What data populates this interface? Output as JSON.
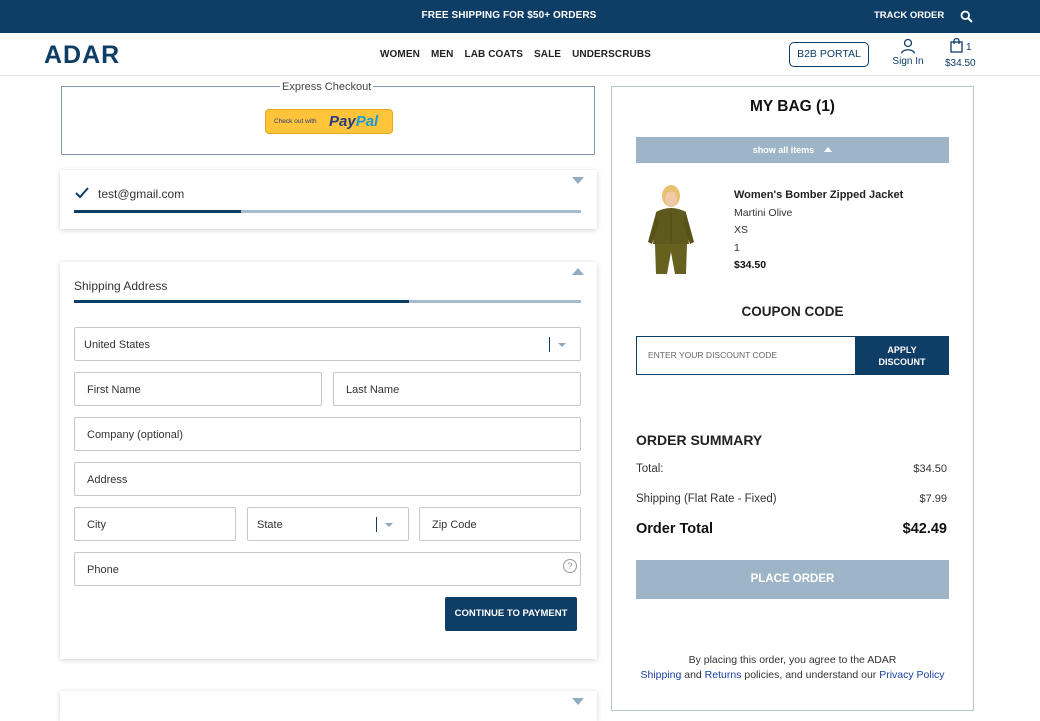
{
  "banner": {
    "promo": "FREE SHIPPING FOR $50+ ORDERS",
    "track_order": "TRACK ORDER",
    "search_icon": "search-icon"
  },
  "header": {
    "logo": "ADAR",
    "nav": [
      "WOMEN",
      "MEN",
      "LAB COATS",
      "SALE",
      "UNDERSCRUBS"
    ],
    "b2b": "B2B PORTAL",
    "sign_in": "Sign In",
    "cart_count": "1",
    "cart_total": "$34.50"
  },
  "express": {
    "legend": "Express Checkout",
    "paypal_small": "Check out with",
    "paypal_pay": "Pay",
    "paypal_pal": "Pal"
  },
  "email_step": {
    "email": "test@gmail.com",
    "progress": 0.33
  },
  "shipping": {
    "title": "Shipping Address",
    "progress": 0.66,
    "country": "United States",
    "first_name": "First Name",
    "last_name": "Last Name",
    "company": "Company (optional)",
    "address": "Address",
    "city": "City",
    "state": "State",
    "zip": "Zip Code",
    "phone": "Phone",
    "help": "?",
    "continue": "CONTINUE TO PAYMENT"
  },
  "bag": {
    "title": "MY BAG (1)",
    "show_all": "show all items",
    "item": {
      "name": "Women's Bomber Zipped Jacket",
      "color": "Martini Olive",
      "size": "XS",
      "qty": "1",
      "price": "$34.50"
    },
    "coupon_title": "COUPON CODE",
    "coupon_placeholder": "ENTER YOUR DISCOUNT CODE",
    "apply_line1": "APPLY",
    "apply_line2": "DISCOUNT",
    "summary_title": "ORDER SUMMARY",
    "total_label": "Total:",
    "total_value": "$34.50",
    "shipping_label": "Shipping (Flat Rate - Fixed)",
    "shipping_value": "$7.99",
    "order_total_label": "Order Total",
    "order_total_value": "$42.49",
    "place_order": "PLACE ORDER",
    "legal_1": "By placing this order, you agree to the ADAR",
    "legal_shipping": "Shipping",
    "legal_and": " and ",
    "legal_returns": "Returns",
    "legal_2": " policies, and understand our ",
    "legal_privacy": "Privacy Policy"
  },
  "colors": {
    "brand_navy": "#0e3d66",
    "muted_blue": "#9db5c6",
    "product_olive": "#5e5a1e"
  }
}
